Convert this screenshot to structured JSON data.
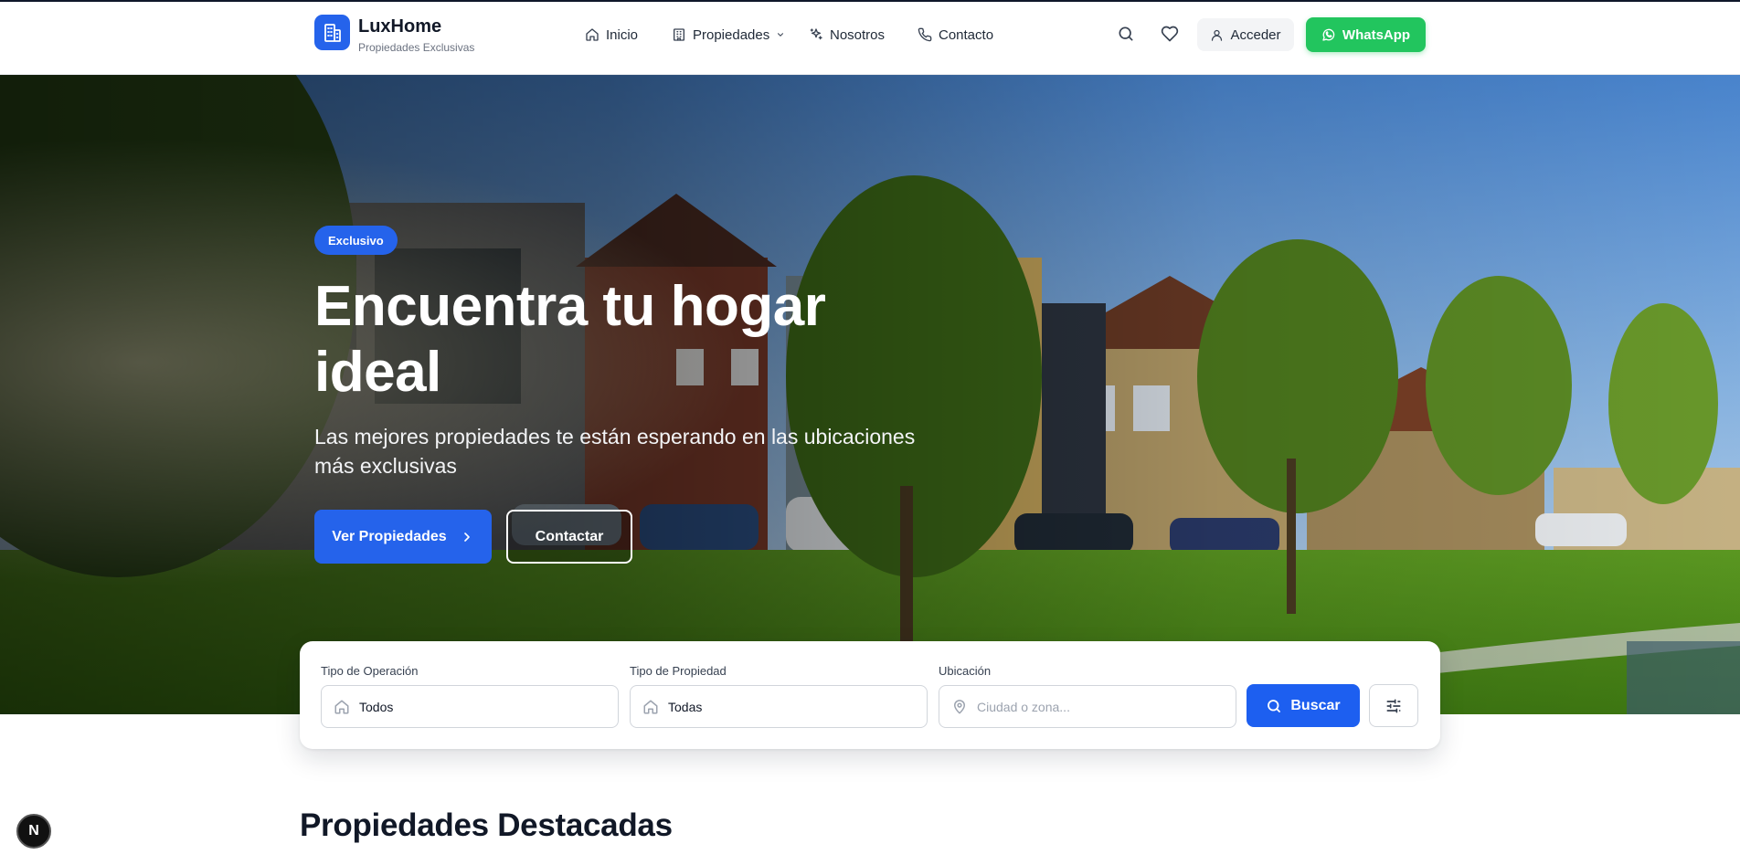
{
  "brand": {
    "name": "LuxHome",
    "tagline": "Propiedades Exclusivas",
    "accent": "#2563eb"
  },
  "nav": {
    "items": [
      {
        "label": "Inicio",
        "icon": "home-icon"
      },
      {
        "label": "Propiedades",
        "icon": "building-icon",
        "dropdown": true
      },
      {
        "label": "Nosotros",
        "icon": "sparkles-icon"
      },
      {
        "label": "Contacto",
        "icon": "phone-icon"
      }
    ]
  },
  "header_actions": {
    "search_icon": "search-icon",
    "favorites_icon": "heart-icon",
    "login_label": "Acceder",
    "whatsapp_label": "WhatsApp",
    "whatsapp_color": "#22c55e"
  },
  "hero": {
    "badge": "Exclusivo",
    "title": "Encuentra tu hogar ideal",
    "subtitle": "Las mejores propiedades te están esperando en las ubicaciones más exclusivas",
    "primary_cta": "Ver Propiedades",
    "secondary_cta": "Contactar"
  },
  "search": {
    "operation": {
      "label": "Tipo de Operación",
      "value": "Todos",
      "icon": "home-icon"
    },
    "property_type": {
      "label": "Tipo de Propiedad",
      "value": "Todas",
      "icon": "home-icon"
    },
    "location": {
      "label": "Ubicación",
      "placeholder": "Ciudad o zona...",
      "icon": "map-pin-icon"
    },
    "submit_label": "Buscar",
    "filters_icon": "sliders-icon"
  },
  "featured": {
    "title": "Propiedades Destacadas"
  },
  "dev_badge": {
    "label": "N"
  }
}
